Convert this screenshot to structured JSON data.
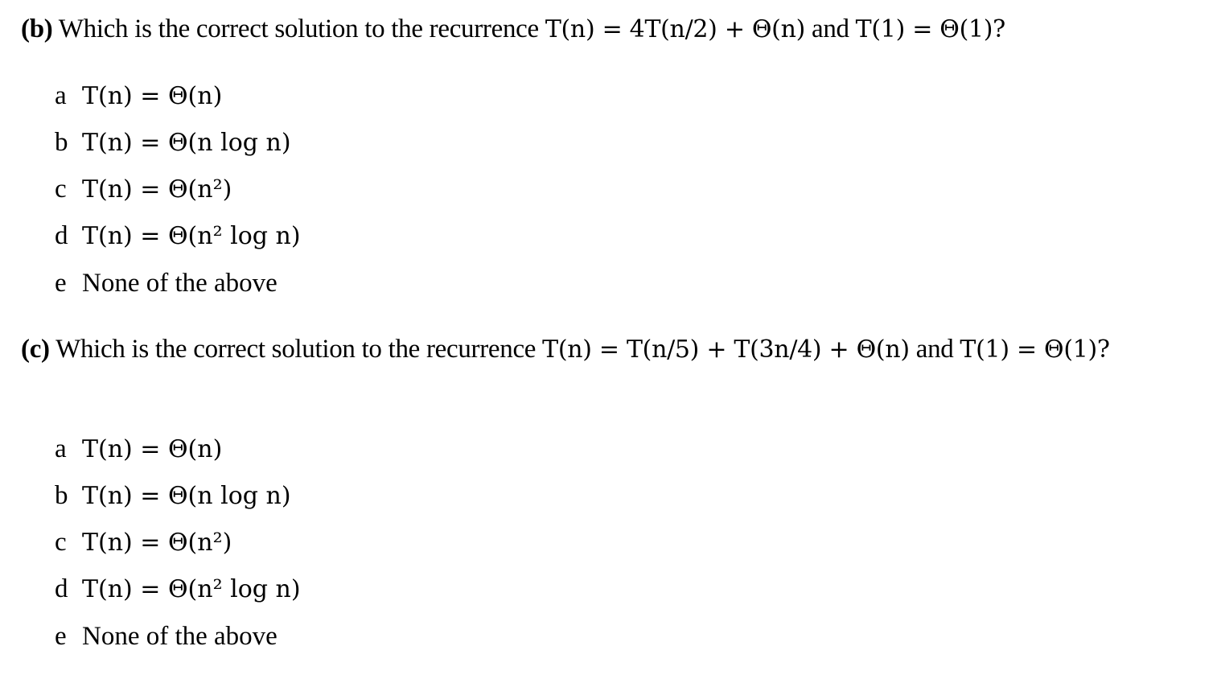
{
  "questions": [
    {
      "label": "(b)",
      "prompt": "Which is the correct solution to the recurrence",
      "recurrence": "T(n) = 4T(n/2) + Θ(n)",
      "connector": "and",
      "base_case": "T(1) = Θ(1)?",
      "options": [
        {
          "letter": "a",
          "text": "T(n) = Θ(n)"
        },
        {
          "letter": "b",
          "text": "T(n) = Θ(n log n)"
        },
        {
          "letter": "c",
          "text": "T(n) = Θ(n²)"
        },
        {
          "letter": "d",
          "text": "T(n) = Θ(n² log n)"
        },
        {
          "letter": "e",
          "text": "None of the above"
        }
      ]
    },
    {
      "label": "(c)",
      "prompt": "Which is the correct solution to the recurrence",
      "recurrence": "T(n) = T(n/5) + T(3n/4) + Θ(n)",
      "connector": "and",
      "base_case": "T(1) = Θ(1)?",
      "options": [
        {
          "letter": "a",
          "text": "T(n) = Θ(n)"
        },
        {
          "letter": "b",
          "text": "T(n) = Θ(n log n)"
        },
        {
          "letter": "c",
          "text": "T(n) = Θ(n²)"
        },
        {
          "letter": "d",
          "text": "T(n) = Θ(n² log n)"
        },
        {
          "letter": "e",
          "text": "None of the above"
        }
      ]
    }
  ]
}
